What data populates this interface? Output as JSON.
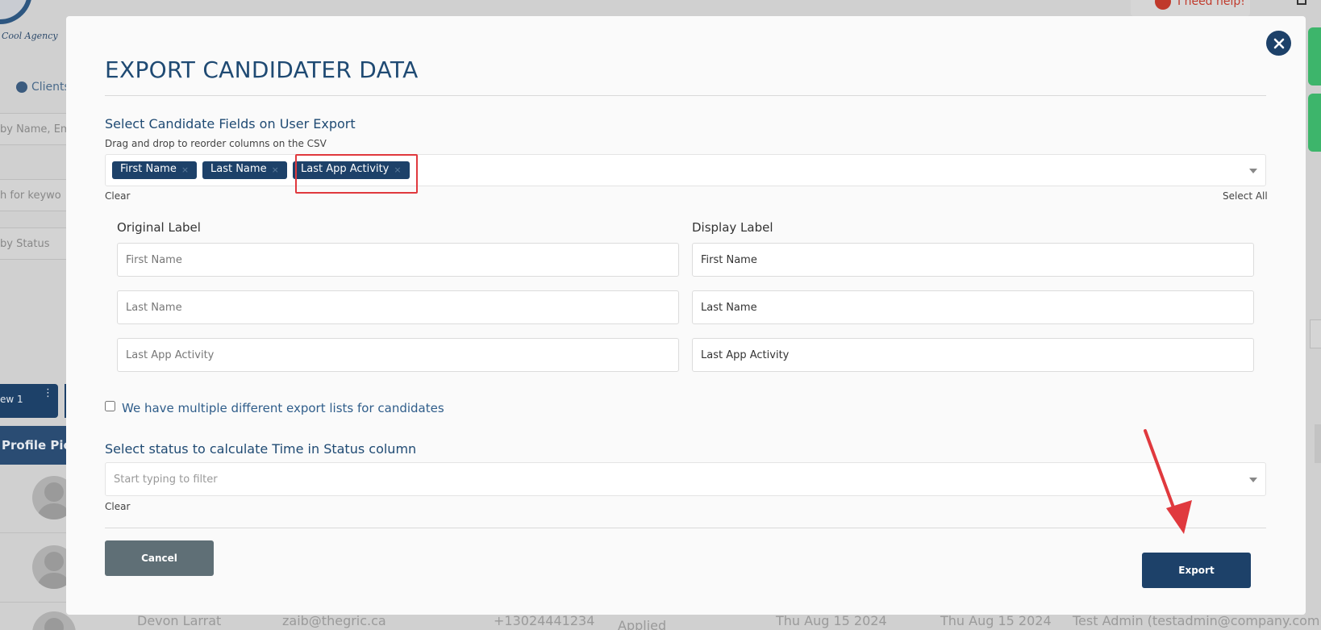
{
  "background": {
    "logo_text": "Cool Agency",
    "clients_label": "Clients",
    "search_placeholder": "by Name, Em",
    "keyword_placeholder": "h for keywo",
    "status_filter": "by Status",
    "view_tab": "ew 1",
    "profile_header": "Profile Pict",
    "help_label": "I need help!",
    "bottom_row": {
      "name": "Devon Larrat",
      "email": "zaib@thegric.ca",
      "phone": "+13024441234",
      "status": "Applied",
      "date1": "Thu Aug 15 2024",
      "date2": "Thu Aug 15 2024",
      "owner": "Test Admin (testadmin@company.com)"
    }
  },
  "modal": {
    "title": "EXPORT CANDIDATER DATA",
    "fields_section": {
      "label": "Select Candidate Fields on User Export",
      "help": "Drag and drop to reorder columns on the CSV",
      "chips": [
        {
          "label": "First Name"
        },
        {
          "label": "Last Name"
        },
        {
          "label": "Last App Activity"
        }
      ],
      "chip_remove_glyph": "×",
      "clear_label": "Clear",
      "select_all_label": "Select All"
    },
    "labels_table": {
      "original_header": "Original Label",
      "display_header": "Display Label",
      "rows": [
        {
          "original_placeholder": "First Name",
          "display_value": "First Name"
        },
        {
          "original_placeholder": "Last Name",
          "display_value": "Last Name"
        },
        {
          "original_placeholder": "Last App Activity",
          "display_value": "Last App Activity"
        }
      ]
    },
    "multiple_lists_label": "We have multiple different export lists for candidates",
    "status_section": {
      "label": "Select status to calculate Time in Status column",
      "placeholder": "Start typing to filter",
      "clear_label": "Clear"
    },
    "cancel_label": "Cancel",
    "export_label": "Export"
  },
  "colors": {
    "primary": "#1d4169",
    "cancel": "#5f6f76",
    "highlight": "#e0393e",
    "green_tab": "#3db56b"
  }
}
